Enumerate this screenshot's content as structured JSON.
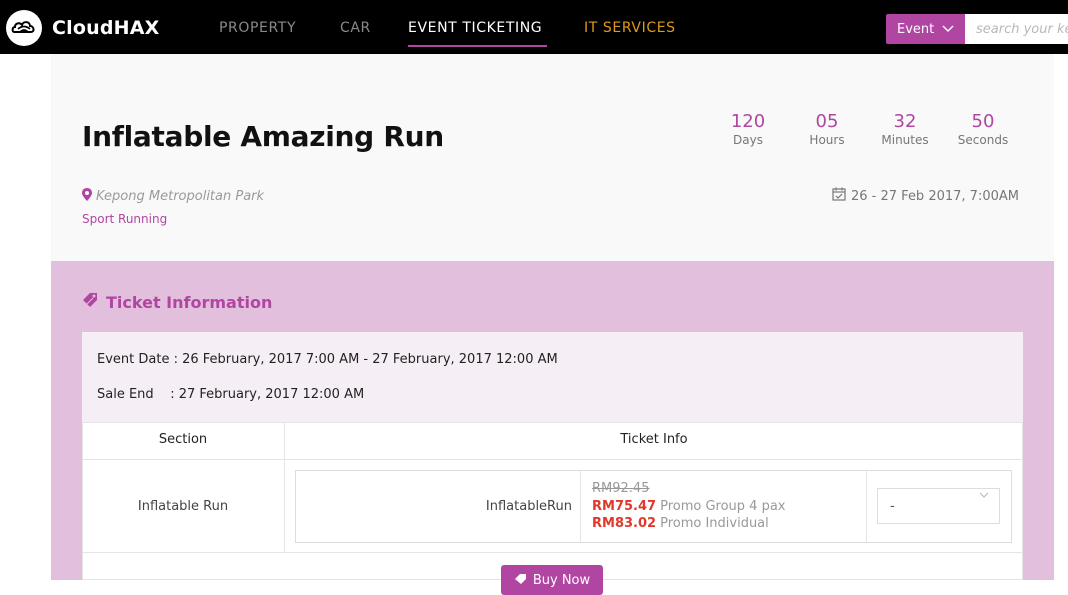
{
  "brand": {
    "name": "CloudHAX"
  },
  "nav": {
    "items": [
      {
        "label": "PROPERTY"
      },
      {
        "label": "CAR"
      },
      {
        "label": "EVENT TICKETING"
      },
      {
        "label": "IT SERVICES"
      }
    ],
    "active": "EVENT TICKETING"
  },
  "search": {
    "category": "Event",
    "placeholder": "search your ke"
  },
  "event": {
    "title": "Inflatable Amazing Run",
    "venue": "Kepong Metropolitan Park",
    "category": "Sport Running",
    "date_range": "26 - 27 Feb 2017, 7:00AM"
  },
  "countdown": {
    "days": {
      "value": "120",
      "label": "Days"
    },
    "hours": {
      "value": "05",
      "label": "Hours"
    },
    "minutes": {
      "value": "32",
      "label": "Minutes"
    },
    "seconds": {
      "value": "50",
      "label": "Seconds"
    }
  },
  "ticket_info": {
    "heading": "Ticket Information",
    "event_date": "Event Date : 26 February, 2017 7:00 AM - 27 February, 2017 12:00 AM",
    "sale_end": "Sale End    : 27 February, 2017 12:00 AM",
    "columns": [
      "Section",
      "Ticket Info"
    ],
    "rows": [
      {
        "section": "Inflatable Run",
        "ticket_name": "InflatableRun",
        "original_price": "RM92.45",
        "prices": [
          {
            "amount": "RM75.47",
            "label": "Promo Group 4 pax"
          },
          {
            "amount": "RM83.02",
            "label": "Promo Individual"
          }
        ],
        "quantity": "-"
      }
    ],
    "buy_label": "Buy Now"
  },
  "colors": {
    "accent": "#b146a2",
    "price": "#e0392b",
    "section_bg": "#e2bfdc"
  }
}
